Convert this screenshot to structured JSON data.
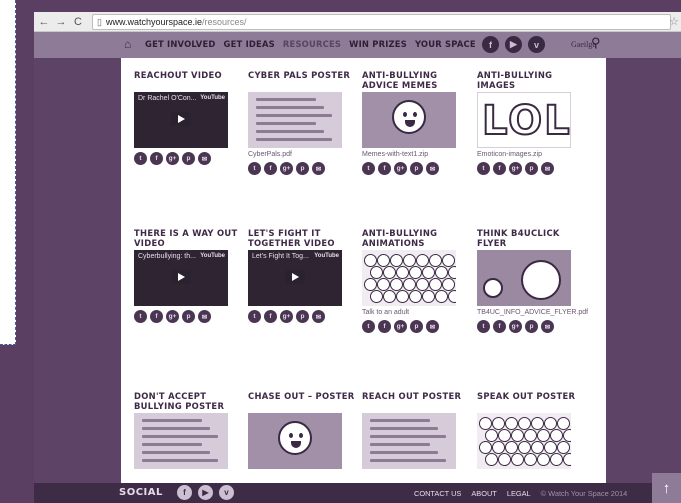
{
  "browser": {
    "url_host": "www.watchyourspace.ie",
    "url_path": "/resources/"
  },
  "nav": {
    "links": [
      "GET INVOLVED",
      "GET IDEAS",
      "RESOURCES",
      "WIN PRIZES",
      "YOUR SPACE"
    ],
    "active": "RESOURCES",
    "language": "Gaeilge"
  },
  "resources": [
    {
      "title": "REACHOUT VIDEO",
      "thumb_type": "video",
      "video_title": "Dr Rachel O'Con...",
      "yt": "YouTube",
      "caption": ""
    },
    {
      "title": "CYBER PALS POSTER",
      "thumb_type": "doc",
      "caption": "CyberPals.pdf"
    },
    {
      "title": "ANTI-BULLYING ADVICE MEMES",
      "thumb_type": "face",
      "caption": "Memes-with-text1.zip"
    },
    {
      "title": "ANTI-BULLYING IMAGES",
      "thumb_type": "lol",
      "thumb_text": "LOL",
      "caption": "Emoticon-images.zip"
    },
    {
      "title": "THERE IS A WAY OUT VIDEO",
      "thumb_type": "video",
      "video_title": "Cyberbullying: th...",
      "yt": "YouTube",
      "caption": ""
    },
    {
      "title": "LET'S FIGHT IT TOGETHER VIDEO",
      "thumb_type": "video",
      "video_title": "Let's Fight It Tog...",
      "yt": "YouTube",
      "caption": ""
    },
    {
      "title": "ANTI-BULLYING ANIMATIONS",
      "thumb_type": "crowd",
      "caption": "Talk to an adult"
    },
    {
      "title": "THINK B4UCLICK FLYER",
      "thumb_type": "flyer",
      "caption": "TB4UC_INFO_ADVICE_FLYER.pdf"
    },
    {
      "title": "DON'T ACCEPT BULLYING POSTER",
      "thumb_type": "doc",
      "caption": ""
    },
    {
      "title": "CHASE OUT – POSTER",
      "thumb_type": "face",
      "caption": ""
    },
    {
      "title": "REACH OUT POSTER",
      "thumb_type": "doc",
      "caption": ""
    },
    {
      "title": "SPEAK OUT POSTER",
      "thumb_type": "crowd",
      "caption": ""
    }
  ],
  "share_icons": [
    "twitter-icon",
    "facebook-icon",
    "google-plus-icon",
    "pinterest-icon",
    "email-icon"
  ],
  "footer": {
    "social_label": "SOCIAL",
    "links": [
      "CONTACT US",
      "ABOUT",
      "LEGAL"
    ],
    "copyright": "© Watch Your Space 2014"
  },
  "colors": {
    "brand_purple": "#5a3f63",
    "nav_bar": "#8e7b97",
    "footer": "#3e2c46",
    "title_text": "#3f2a47"
  }
}
